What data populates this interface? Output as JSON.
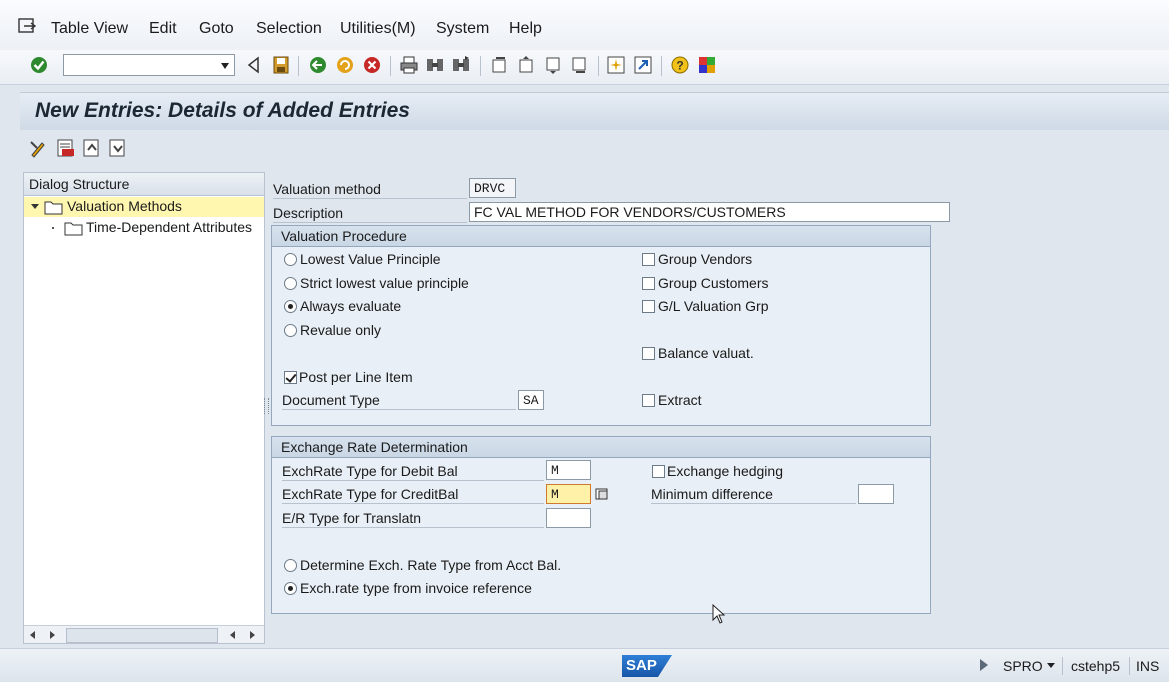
{
  "menu": {
    "items": [
      "Table View",
      "Edit",
      "Goto",
      "Selection",
      "Utilities(M)",
      "System",
      "Help"
    ]
  },
  "toolbar": {
    "command_value": ""
  },
  "title": "New Entries: Details of Added Entries",
  "dialog_structure": {
    "header": "Dialog Structure",
    "items": [
      "Valuation Methods",
      "Time-Dependent Attributes"
    ]
  },
  "form": {
    "valuation_method_label": "Valuation method",
    "valuation_method_value": "DRVC",
    "description_label": "Description",
    "description_value": "FC VAL METHOD FOR VENDORS/CUSTOMERS"
  },
  "valuation_procedure": {
    "title": "Valuation Procedure",
    "radios": [
      {
        "label": "Lowest Value Principle",
        "selected": false
      },
      {
        "label": "Strict lowest value principle",
        "selected": false
      },
      {
        "label": "Always evaluate",
        "selected": true
      },
      {
        "label": "Revalue only",
        "selected": false
      }
    ],
    "post_per_line_item": "Post per Line Item",
    "document_type_label": "Document Type",
    "document_type_value": "SA",
    "checks": {
      "group_vendors": "Group Vendors",
      "group_customers": "Group Customers",
      "gl_valuation_grp": "G/L Valuation Grp",
      "balance_valuat": "Balance valuat.",
      "extract": "Extract"
    }
  },
  "exchange_rate": {
    "title": "Exchange Rate Determination",
    "debit_label": "ExchRate Type for Debit Bal",
    "debit_value": "M",
    "credit_label": "ExchRate Type for CreditBal",
    "credit_value": "M",
    "translatn_label": "E/R Type for Translatn",
    "translatn_value": "",
    "exchange_hedging": "Exchange hedging",
    "minimum_difference": "Minimum difference",
    "minimum_difference_value": "",
    "radio_acct_bal": "Determine Exch. Rate Type from Acct Bal.",
    "radio_invoice_ref": "Exch.rate type from invoice reference"
  },
  "status": {
    "logo": "SAP",
    "transaction": "SPRO",
    "server": "cstehp5",
    "mode": "INS"
  }
}
